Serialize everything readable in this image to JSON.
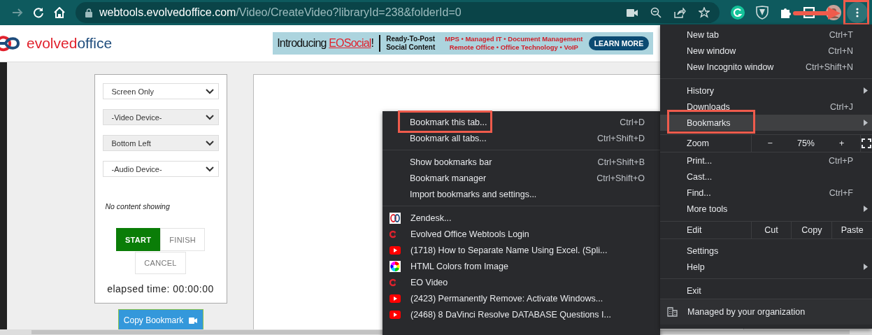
{
  "browser": {
    "url_host": "webtools.evolvedoffice.com",
    "url_path": "/Video/CreateVideo?libraryId=238&folderId=0",
    "menu_button": {
      "annotated": true
    }
  },
  "header": {
    "logo": {
      "part_1": "evolved",
      "part_2": "office"
    },
    "banner": {
      "intro": "Introducing",
      "brand": "EOSocial",
      "bang": "!",
      "tagline_1": "Ready-To-Post",
      "tagline_2": "Social Content",
      "services_1": "MPS • Managed IT • Document Management",
      "services_2": "Remote Office • Office Technology • VoIP",
      "button": "LEARN MORE"
    }
  },
  "recorder": {
    "selects": [
      {
        "value": "Screen Only",
        "disabled": false
      },
      {
        "value": "-Video Device-",
        "disabled": true
      },
      {
        "value": "Bottom Left",
        "disabled": true
      },
      {
        "value": "-Audio Device-",
        "disabled": false
      }
    ],
    "status": "No content showing",
    "buttons": [
      {
        "label": "START",
        "primary": true
      },
      {
        "label": "FINISH",
        "primary": false
      }
    ],
    "cancel": "CANCEL",
    "elapsed": "elapsed time: 00:00:00",
    "copy_button": "Copy Bookmark"
  },
  "bookmarks_menu": {
    "items": [
      {
        "kind": "item",
        "label": "Bookmark this tab...",
        "shortcut": "Ctrl+D",
        "annotated": true
      },
      {
        "kind": "item",
        "label": "Bookmark all tabs...",
        "shortcut": "Ctrl+Shift+D",
        "annotated": false
      },
      {
        "kind": "separator"
      },
      {
        "kind": "item",
        "label": "Show bookmarks bar",
        "shortcut": "Ctrl+Shift+B",
        "annotated": false
      },
      {
        "kind": "item",
        "label": "Bookmark manager",
        "shortcut": "Ctrl+Shift+O",
        "annotated": false
      },
      {
        "kind": "item",
        "label": "Import bookmarks and settings...",
        "annotated": false
      },
      {
        "kind": "separator"
      },
      {
        "kind": "bookmark",
        "label": "Zendesk..."
      },
      {
        "kind": "bookmark",
        "label": "Evolved Office Webtools Login"
      },
      {
        "kind": "bookmark",
        "label": "(1718) How to Separate Name Using Excel. (Spli..."
      },
      {
        "kind": "bookmark",
        "label": "HTML Colors from Image"
      },
      {
        "kind": "bookmark",
        "label": "EO Video"
      },
      {
        "kind": "bookmark",
        "label": "(2423) Permanently Remove: Activate Windows..."
      },
      {
        "kind": "bookmark",
        "label": "(2468) 8 DaVinci Resolve DATABASE Questions I..."
      }
    ]
  },
  "main_menu": {
    "items": [
      {
        "kind": "item",
        "label": "New tab",
        "shortcut": "Ctrl+T",
        "selected": false,
        "submenu": false,
        "annotated": false
      },
      {
        "kind": "item",
        "label": "New window",
        "shortcut": "Ctrl+N",
        "selected": false,
        "submenu": false,
        "annotated": false
      },
      {
        "kind": "item",
        "label": "New Incognito window",
        "shortcut": "Ctrl+Shift+N",
        "selected": false,
        "submenu": false,
        "annotated": false
      },
      {
        "kind": "separator"
      },
      {
        "kind": "item",
        "label": "History",
        "selected": false,
        "submenu": true,
        "annotated": false
      },
      {
        "kind": "item",
        "label": "Downloads",
        "shortcut": "Ctrl+J",
        "selected": false,
        "submenu": false,
        "annotated": false
      },
      {
        "kind": "item",
        "label": "Bookmarks",
        "selected": true,
        "submenu": true,
        "annotated": true
      },
      {
        "kind": "zoom",
        "label": "Zoom",
        "minus": "−",
        "value": "75%",
        "plus": "+"
      },
      {
        "kind": "item",
        "label": "Print...",
        "shortcut": "Ctrl+P",
        "selected": false,
        "submenu": false,
        "annotated": false
      },
      {
        "kind": "item",
        "label": "Cast...",
        "selected": false,
        "submenu": false,
        "annotated": false
      },
      {
        "kind": "item",
        "label": "Find...",
        "shortcut": "Ctrl+F",
        "selected": false,
        "submenu": false,
        "annotated": false
      },
      {
        "kind": "item",
        "label": "More tools",
        "selected": false,
        "submenu": true,
        "annotated": false
      },
      {
        "kind": "edit",
        "label": "Edit",
        "actions": [
          "Cut",
          "Copy",
          "Paste"
        ]
      },
      {
        "kind": "item",
        "label": "Settings",
        "selected": false,
        "submenu": false,
        "annotated": false
      },
      {
        "kind": "item",
        "label": "Help",
        "selected": false,
        "submenu": true,
        "annotated": false
      },
      {
        "kind": "separator"
      },
      {
        "kind": "item",
        "label": "Exit",
        "selected": false,
        "submenu": false,
        "annotated": false
      },
      {
        "kind": "managed",
        "label": "Managed by your organization"
      }
    ]
  }
}
